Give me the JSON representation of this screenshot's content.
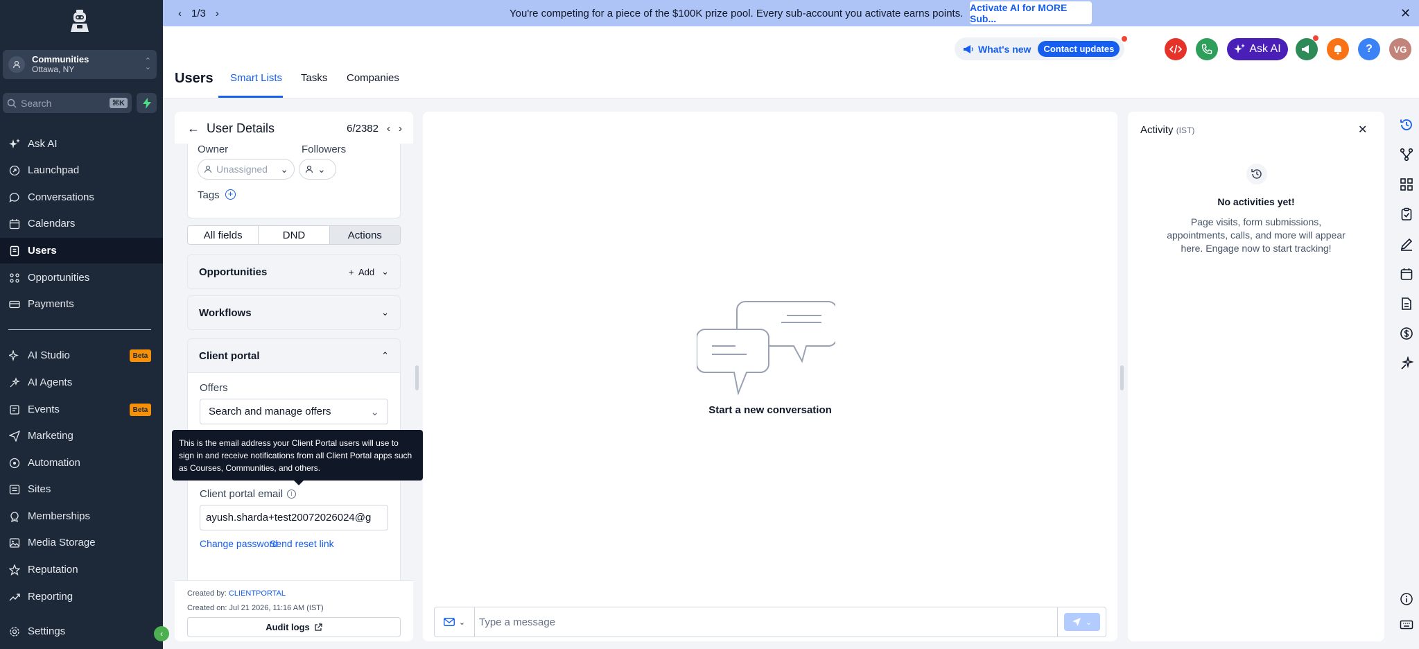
{
  "sidebar": {
    "account": {
      "name": "Communities",
      "location": "Ottawa, NY"
    },
    "search": {
      "placeholder": "Search",
      "shortcut": "⌘K"
    },
    "items": [
      {
        "label": "Ask AI",
        "icon": "sparkle-icon"
      },
      {
        "label": "Launchpad",
        "icon": "rocket-icon"
      },
      {
        "label": "Conversations",
        "icon": "chat-icon"
      },
      {
        "label": "Calendars",
        "icon": "calendar-icon"
      },
      {
        "label": "Users",
        "icon": "contacts-icon",
        "active": true
      },
      {
        "label": "Opportunities",
        "icon": "opportunities-icon"
      },
      {
        "label": "Payments",
        "icon": "payments-icon"
      },
      {
        "label": "AI Studio",
        "icon": "ai-studio-icon",
        "badge": "Beta"
      },
      {
        "label": "AI Agents",
        "icon": "ai-agents-icon"
      },
      {
        "label": "Events",
        "icon": "events-icon",
        "badge": "Beta"
      },
      {
        "label": "Marketing",
        "icon": "send-icon"
      },
      {
        "label": "Automation",
        "icon": "automation-icon"
      },
      {
        "label": "Sites",
        "icon": "sites-icon"
      },
      {
        "label": "Memberships",
        "icon": "memberships-icon"
      },
      {
        "label": "Media Storage",
        "icon": "image-icon"
      },
      {
        "label": "Reputation",
        "icon": "star-icon"
      },
      {
        "label": "Reporting",
        "icon": "chart-icon"
      },
      {
        "label": "Settings",
        "icon": "gear-icon"
      }
    ]
  },
  "banner": {
    "pager": "1/3",
    "message": "You're competing for a piece of the $100K prize pool. Every sub-account you activate earns points.",
    "cta": "Activate AI for MORE Sub..."
  },
  "header": {
    "title": "Users",
    "tabs": [
      "Smart Lists",
      "Tasks",
      "Companies"
    ],
    "whats_new": "What's new",
    "contact_updates": "Contact updates",
    "ask_ai": "Ask AI",
    "help": "?",
    "avatar_initials": "VG"
  },
  "user_details": {
    "title": "User Details",
    "position": "6/2382",
    "owner_label": "Owner",
    "owner_value": "Unassigned",
    "followers_label": "Followers",
    "tags_label": "Tags",
    "segments": [
      "All fields",
      "DND",
      "Actions"
    ],
    "opportunities_label": "Opportunities",
    "add_label": "Add",
    "workflows_label": "Workflows",
    "client_portal_label": "Client portal",
    "offers_label": "Offers",
    "offers_placeholder": "Search and manage offers",
    "tooltip": "This is the email address your Client Portal users will use to sign in and receive notifications from all Client Portal apps such as Courses, Communities, and others.",
    "portal_email_label": "Client portal email",
    "portal_email_value": "ayush.sharda+test20072026024@g",
    "change_password": "Change password",
    "send_reset_link": "Send reset link",
    "created_by_label": "Created by:",
    "created_by_value": "CLIENTPORTAL",
    "created_on": "Created on: Jul 21 2026, 11:16 AM (IST)",
    "audit_logs": "Audit logs"
  },
  "conversation": {
    "empty_text": "Start a new conversation",
    "composer_placeholder": "Type a message"
  },
  "activity": {
    "title": "Activity",
    "timezone": "(IST)",
    "empty_title": "No activities yet!",
    "empty_desc": "Page visits, form submissions, appointments, calls, and more will appear here. Engage now to start tracking!"
  },
  "colors": {
    "sidebar_bg": "#1d2939",
    "accent": "#155eef",
    "banner_bg": "#aec4f7",
    "ask_ai_bg": "#4a1fb8"
  }
}
